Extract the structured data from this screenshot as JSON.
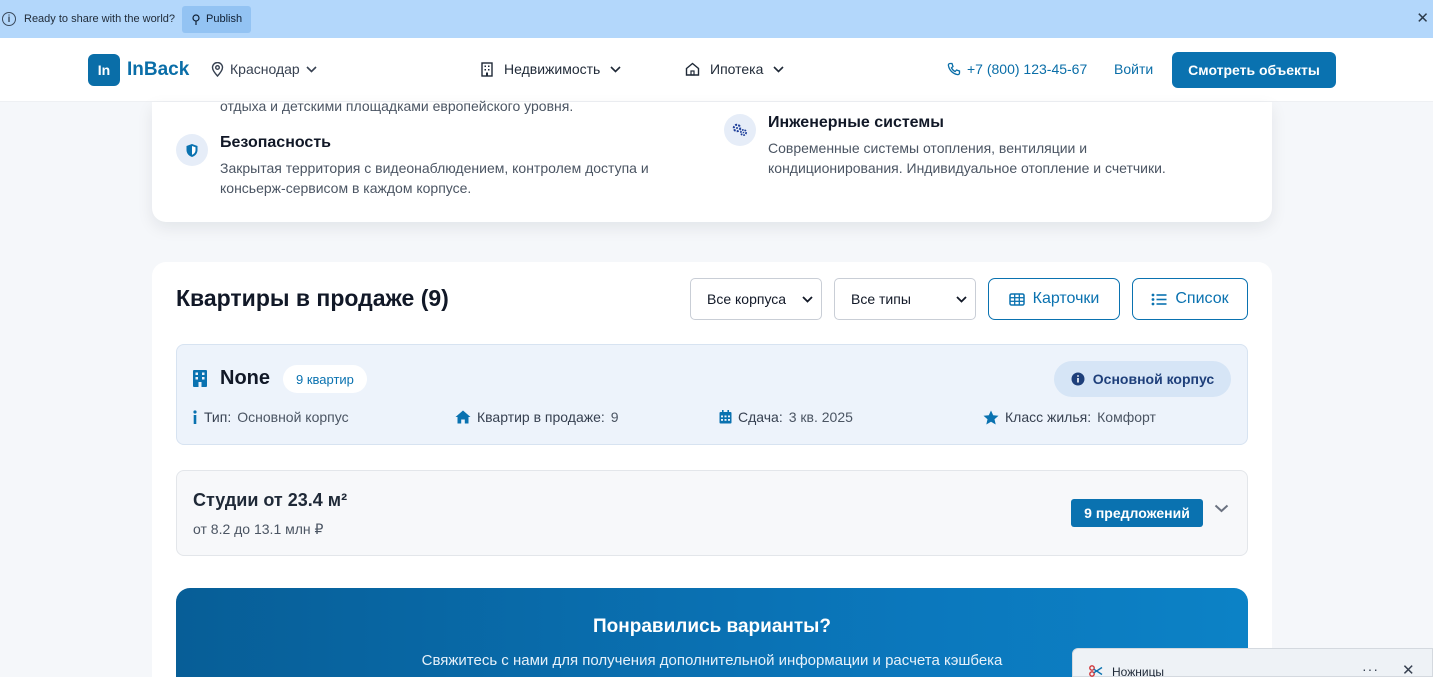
{
  "publish_bar": {
    "message": "Ready to share with the world?",
    "publish_label": "Publish",
    "close_glyph": "✕"
  },
  "header": {
    "logo_mark": "In",
    "logo_text": "InBack",
    "city": "Краснодар",
    "nav": [
      {
        "label": "Недвижимость",
        "icon": "building-icon"
      },
      {
        "label": "Ипотека",
        "icon": "home-icon"
      }
    ],
    "phone": "+7 (800) 123-45-67",
    "login": "Войти",
    "cta": "Смотреть объекты"
  },
  "features": {
    "cut_text": "отдыха и детскими площадками европейского уровня.",
    "items": [
      {
        "title": "Безопасность",
        "desc": "Закрытая территория с видеонаблюдением, контролем доступа и консьерж-сервисом в каждом корпусе.",
        "icon": "shield-icon"
      },
      {
        "title": "Инженерные системы",
        "desc": "Современные системы отопления, вентиляции и кондиционирования. Индивидуальное отопление и счетчики.",
        "icon": "gears-icon"
      }
    ]
  },
  "apartments": {
    "title": "Квартиры в продаже (9)",
    "filters": [
      "Все корпуса",
      "Все типы"
    ],
    "view_cards": "Карточки",
    "view_list": "Список",
    "building": {
      "name": "None",
      "count_badge": "9 квартир",
      "main_badge": "Основной корпус",
      "meta": [
        {
          "label": "Тип:",
          "value": "Основной корпус",
          "icon": "info-icon"
        },
        {
          "label": "Квартир в продаже:",
          "value": "9",
          "icon": "home-icon"
        },
        {
          "label": "Сдача:",
          "value": "3 кв. 2025",
          "icon": "calendar-icon"
        },
        {
          "label": "Класс жилья:",
          "value": "Комфорт",
          "icon": "star-icon"
        }
      ]
    },
    "studio": {
      "title": "Студии от 23.4 м²",
      "subtitle": "от 8.2 до 13.1 млн ₽",
      "offers": "9 предложений"
    },
    "promo": {
      "title": "Понравились варианты?",
      "subtitle": "Свяжитесь с нами для получения дополнительной информации и расчета кэшбека"
    }
  },
  "snip": {
    "label": "Ножницы",
    "dots": "···",
    "close": "✕"
  },
  "colors": {
    "brand": "#0a72b0",
    "publish_bar": "#b3d7fb",
    "building_bg": "#edf3fb"
  }
}
